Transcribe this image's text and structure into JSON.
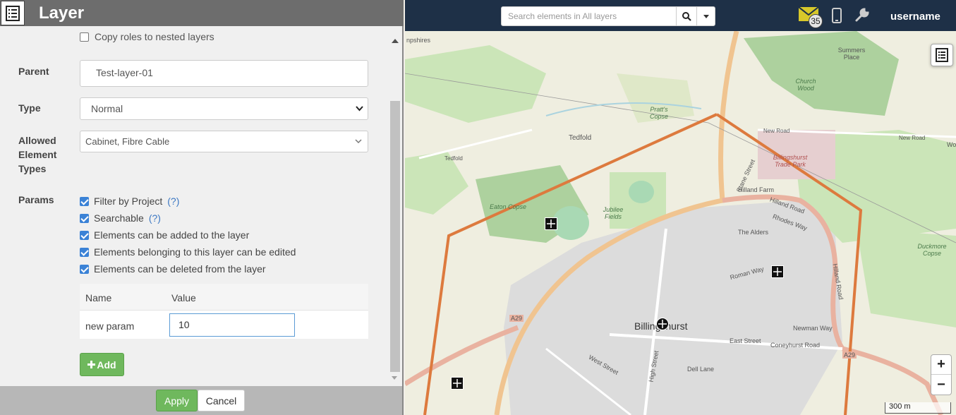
{
  "panel": {
    "title": "Layer",
    "copy_roles_label": "Copy roles to nested layers",
    "parent_label": "Parent",
    "parent_value": "Test-layer-01",
    "type_label": "Type",
    "type_value": "Normal",
    "allowed_label": "Allowed Element Types",
    "allowed_value": "Cabinet, Fibre Cable",
    "params_label": "Params",
    "params": [
      {
        "label": "Filter by Project",
        "help": "(?)",
        "checked": true
      },
      {
        "label": "Searchable",
        "help": "(?)",
        "checked": true
      },
      {
        "label": "Elements can be added to the layer",
        "help": "",
        "checked": true
      },
      {
        "label": "Elements belonging to this layer can be edited",
        "help": "",
        "checked": true
      },
      {
        "label": "Elements can be deleted from the layer",
        "help": "",
        "checked": true
      }
    ],
    "table": {
      "headers": [
        "Name",
        "Value"
      ],
      "rows": [
        {
          "name": "new param",
          "value": "10"
        }
      ]
    },
    "add_label": "Add",
    "apply_label": "Apply",
    "cancel_label": "Cancel"
  },
  "topbar": {
    "search_placeholder": "Search elements in All layers",
    "mail_count": "35",
    "username": "username"
  },
  "map": {
    "labels": {
      "hampshires": "npshires",
      "summers_place": "Summers Place",
      "church_wood": "Church Wood",
      "pratts_copse": "Pratt's Copse",
      "tedfold": "Tedfold",
      "tedfold_road": "Tedfold",
      "new_road": "New Road",
      "new_road2": "New Road",
      "wo": "Wo",
      "trade_park": "Billingshurst Trade Park",
      "stane_street": "Stane Street",
      "hilland_farm": "Hilland Farm",
      "hilland_road": "Hilland Road",
      "hilland_road2": "Hilland Road",
      "eaton_copse": "Eaton Copse",
      "jubilee_fields": "Jubilee Fields",
      "the_alders": "The Alders",
      "rhodes_way": "Rhodes Way",
      "duckmore_copse": "Duckmore Copse",
      "roman_way": "Roman Way",
      "a29": "A29",
      "a29_2": "A29",
      "billingshurst": "Billingshurst",
      "east_street": "East Street",
      "coneyhurst_road": "Coneyhurst Road",
      "newman_way": "Newman Way",
      "west_street": "West Street",
      "dell_lane": "Dell Lane",
      "high_street": "High Street",
      "scale": "300 m"
    }
  }
}
